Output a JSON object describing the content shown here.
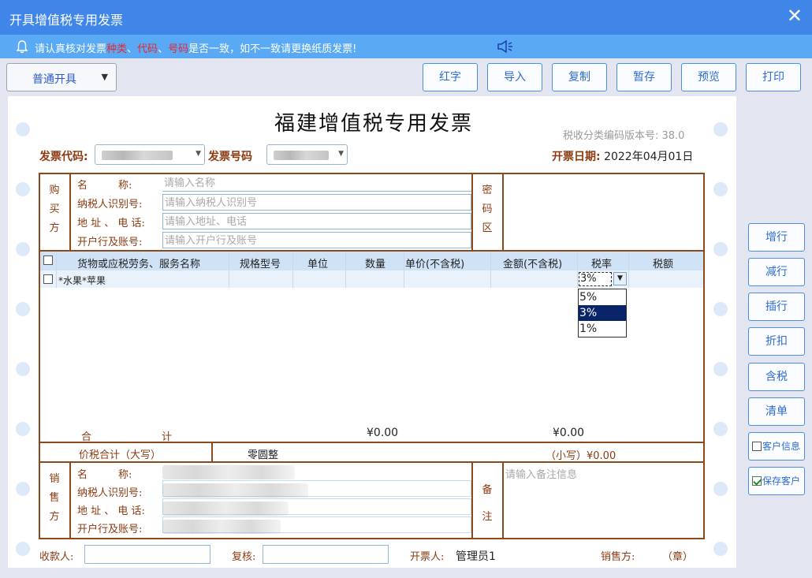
{
  "window": {
    "title": "开具增值税专用发票"
  },
  "notice": {
    "prefix": "请认真核对发票",
    "kind": "种类",
    "sep1": "、",
    "code": "代码",
    "sep2": "、",
    "number": "号码",
    "suffix": "是否一致，如不一致请更换纸质发票!"
  },
  "toolbar": {
    "mode": "普通开具",
    "buttons": [
      "红字",
      "导入",
      "复制",
      "暂存",
      "预览",
      "打印"
    ]
  },
  "side_buttons": [
    "增行",
    "减行",
    "插行",
    "折扣",
    "含税",
    "清单"
  ],
  "side_checks": [
    {
      "label": "客户信息",
      "checked": false
    },
    {
      "label": "保存客户",
      "checked": true
    }
  ],
  "invoice": {
    "title": "福建增值税专用发票",
    "version": "税收分类编码版本号: 38.0",
    "code_label": "发票代码:",
    "number_label": "发票号码",
    "date_label": "开票日期:",
    "date_value": "2022年04月01日",
    "buyer": {
      "section": [
        "购",
        "买",
        "方"
      ],
      "labels": [
        "名　　　称:",
        "纳税人识别号:",
        "地 址 、 电 话:",
        "开户行及账号:"
      ],
      "placeholders": [
        "请输入名称",
        "请输入纳税人识别号",
        "请输入地址、电话",
        "请输入开户行及账号"
      ]
    },
    "password_area": [
      "密",
      "码",
      "区"
    ],
    "table": {
      "headers": [
        "货物或应税劳务、服务名称",
        "规格型号",
        "单位",
        "数量",
        "单价(不含税)",
        "金额(不含税)",
        "税率",
        "税额"
      ],
      "rows": [
        {
          "name": "*水果*苹果",
          "rate": "3%"
        }
      ],
      "rate_options": [
        "5%",
        "3%",
        "1%"
      ]
    },
    "totals": {
      "label_he": "合",
      "label_ji": "计",
      "amount": "¥0.00",
      "tax": "¥0.00"
    },
    "grand_total": {
      "label": "价税合计（大写）",
      "capital": "零圆整",
      "small": "（小写）¥0.00"
    },
    "seller": {
      "section": [
        "销",
        "售",
        "方"
      ],
      "labels": [
        "名　　　称:",
        "纳税人识别号:",
        "地 址 、 电 话:",
        "开户行及账号:"
      ]
    },
    "remark": {
      "section": [
        "备",
        "注"
      ],
      "placeholder": "请输入备注信息"
    },
    "footer": {
      "payee": "收款人:",
      "reviewer": "复核:",
      "drawer_label": "开票人:",
      "drawer_value": "管理员1",
      "seller_label": "销售方:",
      "seal": "（章）"
    }
  }
}
